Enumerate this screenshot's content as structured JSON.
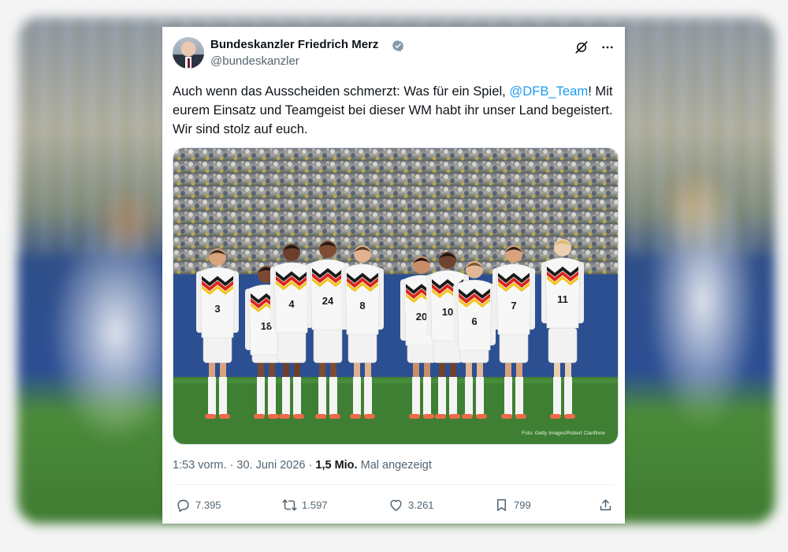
{
  "post": {
    "author_name": "Bundeskanzler Friedrich Merz",
    "handle": "@bundeskanzler",
    "text_before_mention": "Auch wenn das Ausscheiden schmerzt: Was für ein Spiel, ",
    "mention": "@DFB_Team",
    "text_after_mention": "! Mit eurem Einsatz und Teamgeist bei dieser WM habt ihr unser Land begeistert. Wir sind stolz auf euch.",
    "photo_credit": "Foto: Getty Images/Robert Cianflone",
    "time": "1:53 vorm.",
    "separator": "·",
    "date": "30. Juni 2026",
    "views_count": "1,5 Mio.",
    "views_label": "Mal angezeigt"
  },
  "actions": {
    "replies": "7.395",
    "reposts": "1.597",
    "likes": "3.261",
    "bookmarks": "799"
  },
  "players": {
    "numbers": [
      "3",
      "18",
      "4",
      "24",
      "8",
      "20",
      "10",
      "6",
      "7",
      "11"
    ]
  },
  "colors": {
    "text": "#0f1419",
    "secondary": "#536471",
    "link": "#1d9bf0",
    "verified": "#829aab",
    "pitch": "#3f7f33"
  },
  "icons": {
    "verified": "verified-badge-icon",
    "grok": "grok-icon",
    "more": "more-icon",
    "reply": "reply-icon",
    "repost": "repost-icon",
    "like": "heart-icon",
    "bookmark": "bookmark-icon",
    "share": "share-icon"
  }
}
